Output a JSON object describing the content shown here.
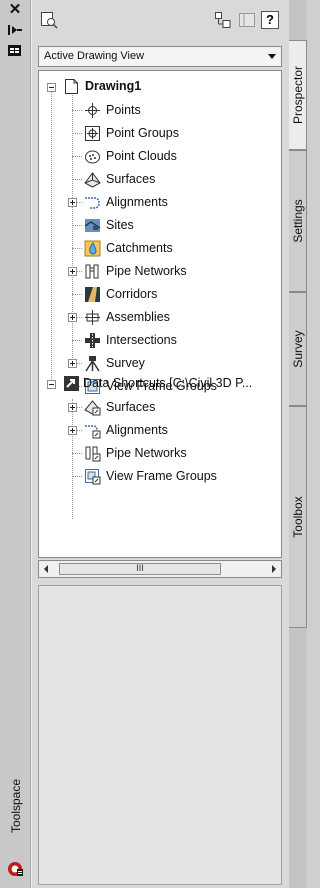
{
  "palette_title": "Toolspace",
  "toolbar": {
    "icons": [
      "preview-icon",
      "item-view-icon",
      "toggle-panel-icon",
      "help-icon"
    ],
    "help_label": "?"
  },
  "view_dropdown": {
    "selected": "Active Drawing View"
  },
  "tree": {
    "drawing": {
      "label": "Drawing1",
      "items": [
        {
          "label": "Points",
          "icon": "points-icon",
          "expandable": false
        },
        {
          "label": "Point Groups",
          "icon": "point-groups-icon",
          "expandable": false
        },
        {
          "label": "Point Clouds",
          "icon": "point-clouds-icon",
          "expandable": false
        },
        {
          "label": "Surfaces",
          "icon": "surfaces-icon",
          "expandable": false
        },
        {
          "label": "Alignments",
          "icon": "alignments-icon",
          "expandable": true
        },
        {
          "label": "Sites",
          "icon": "sites-icon",
          "expandable": false
        },
        {
          "label": "Catchments",
          "icon": "catchments-icon",
          "expandable": false
        },
        {
          "label": "Pipe Networks",
          "icon": "pipe-networks-icon",
          "expandable": true
        },
        {
          "label": "Corridors",
          "icon": "corridors-icon",
          "expandable": false
        },
        {
          "label": "Assemblies",
          "icon": "assemblies-icon",
          "expandable": true
        },
        {
          "label": "Intersections",
          "icon": "intersections-icon",
          "expandable": false
        },
        {
          "label": "Survey",
          "icon": "survey-icon",
          "expandable": true
        },
        {
          "label": "View Frame Groups",
          "icon": "view-frame-groups-icon",
          "expandable": false
        }
      ]
    },
    "shortcuts": {
      "label": "Data Shortcuts [C:\\Civil 3D P...",
      "items": [
        {
          "label": "Surfaces",
          "icon": "shortcut-surfaces-icon",
          "expandable": true
        },
        {
          "label": "Alignments",
          "icon": "shortcut-alignments-icon",
          "expandable": true
        },
        {
          "label": "Pipe Networks",
          "icon": "shortcut-pipe-networks-icon",
          "expandable": false
        },
        {
          "label": "View Frame Groups",
          "icon": "shortcut-view-frame-groups-icon",
          "expandable": false
        }
      ]
    }
  },
  "scrollbar": {
    "thumb_label": "III"
  },
  "tabs": [
    {
      "label": "Prospector",
      "active": true
    },
    {
      "label": "Settings",
      "active": false
    },
    {
      "label": "Survey",
      "active": false
    },
    {
      "label": "Toolbox",
      "active": false
    }
  ],
  "colors": {
    "accent": "#3a6ea5",
    "panel": "#d9d9d9"
  }
}
